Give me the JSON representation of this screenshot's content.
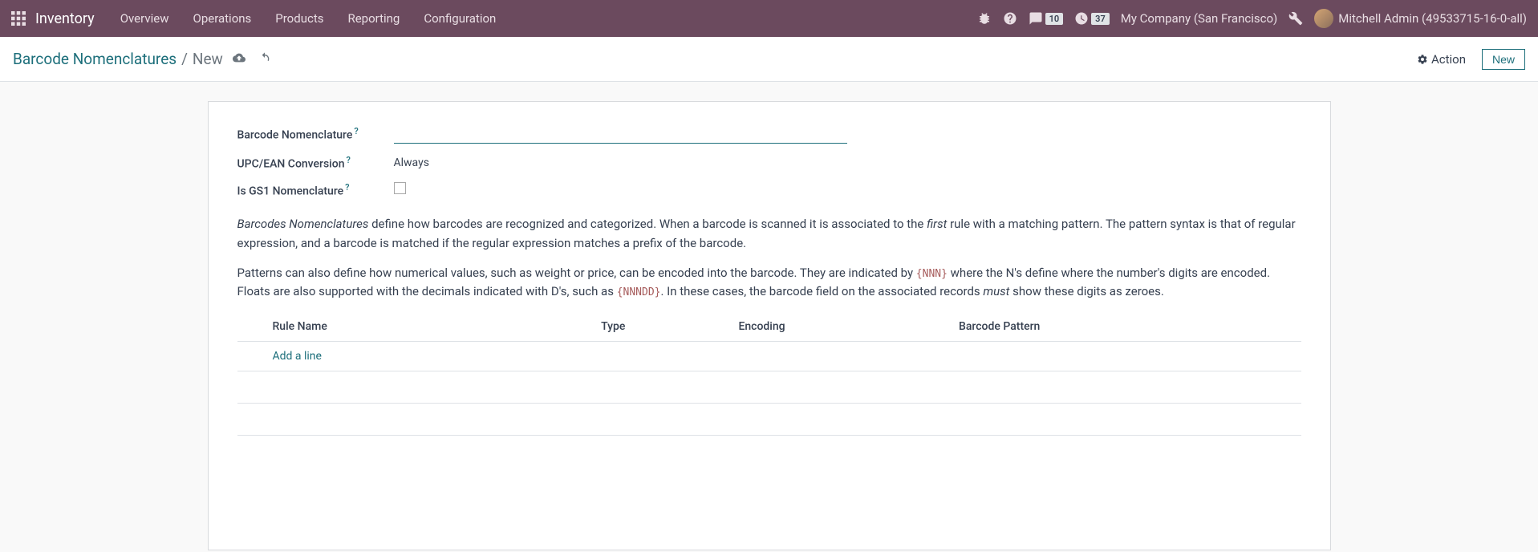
{
  "navbar": {
    "brand": "Inventory",
    "menu": [
      "Overview",
      "Operations",
      "Products",
      "Reporting",
      "Configuration"
    ],
    "msg_count": "10",
    "activity_count": "37",
    "company": "My Company (San Francisco)",
    "user": "Mitchell Admin (49533715-16-0-all)"
  },
  "control": {
    "breadcrumb_root": "Barcode Nomenclatures",
    "breadcrumb_current": "New",
    "action_label": "Action",
    "new_label": "New"
  },
  "form": {
    "nomenclature_label": "Barcode Nomenclature",
    "nomenclature_value": "",
    "conversion_label": "UPC/EAN Conversion",
    "conversion_value": "Always",
    "gs1_label": "Is GS1 Nomenclature",
    "help_q": "?"
  },
  "help": {
    "p1_pre": "Barcodes Nomenclatures",
    "p1_mid": " define how barcodes are recognized and categorized. When a barcode is scanned it is associated to the ",
    "p1_em": "first",
    "p1_post": " rule with a matching pattern. The pattern syntax is that of regular expression, and a barcode is matched if the regular expression matches a prefix of the barcode.",
    "p2_pre": "Patterns can also define how numerical values, such as weight or price, can be encoded into the barcode. They are indicated by ",
    "p2_c1": "{NNN}",
    "p2_mid": " where the N's define where the number's digits are encoded. Floats are also supported with the decimals indicated with D's, such as ",
    "p2_c2": "{NNNDD}",
    "p2_post1": ". In these cases, the barcode field on the associated records ",
    "p2_em": "must",
    "p2_post2": " show these digits as zeroes."
  },
  "table": {
    "col1": "Rule Name",
    "col2": "Type",
    "col3": "Encoding",
    "col4": "Barcode Pattern",
    "add_line": "Add a line"
  }
}
